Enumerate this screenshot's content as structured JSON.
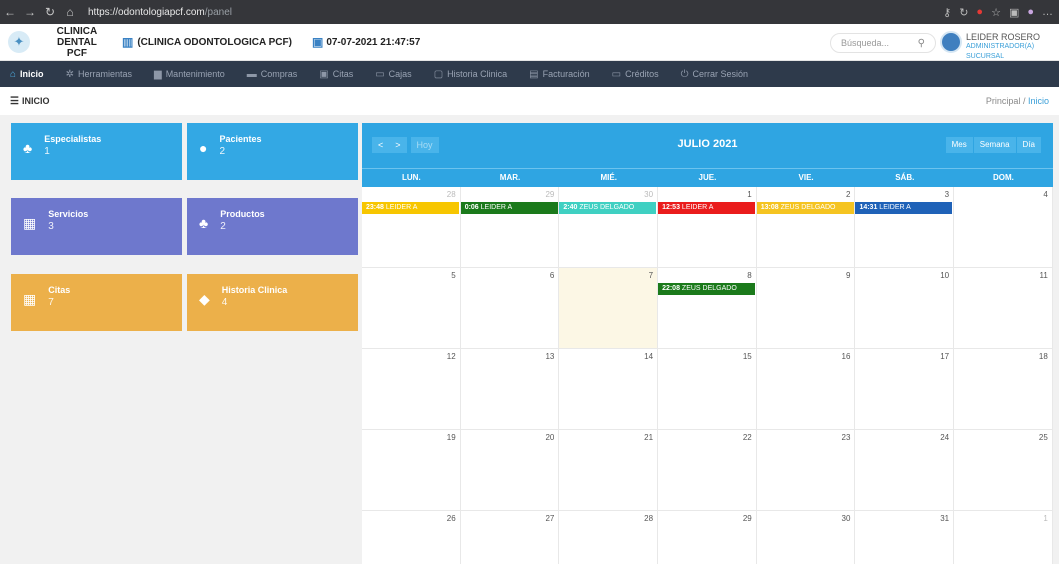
{
  "browser": {
    "url_base": "https://odontologiapcf.com",
    "url_path": "/panel"
  },
  "header": {
    "logo_line1": "CLINICA DENTAL",
    "logo_line2": "PCF",
    "clinic": "(CLINICA ODONTOLOGICA PCF)",
    "datetime": "07-07-2021 21:47:57",
    "search_placeholder": "Búsqueda...",
    "user_name": "LEIDER ROSERO",
    "user_role": "ADMINISTRADOR(A) SUCURSAL"
  },
  "nav": [
    {
      "label": "Inicio",
      "icon": "home-icon",
      "glyph": "⌂",
      "active": true
    },
    {
      "label": "Herramientas",
      "icon": "gear-icon",
      "glyph": "✲",
      "active": false
    },
    {
      "label": "Mantenimiento",
      "icon": "folder-icon",
      "glyph": "▆",
      "active": false
    },
    {
      "label": "Compras",
      "icon": "cart-icon",
      "glyph": "▬",
      "active": false
    },
    {
      "label": "Citas",
      "icon": "calendar-icon",
      "glyph": "▣",
      "active": false
    },
    {
      "label": "Cajas",
      "icon": "monitor-icon",
      "glyph": "▭",
      "active": false
    },
    {
      "label": "Historia Clinica",
      "icon": "chat-icon",
      "glyph": "▢",
      "active": false
    },
    {
      "label": "Facturación",
      "icon": "register-icon",
      "glyph": "▤",
      "active": false
    },
    {
      "label": "Créditos",
      "icon": "card-icon",
      "glyph": "▭",
      "active": false
    },
    {
      "label": "Cerrar Sesión",
      "icon": "power-icon",
      "glyph": "⏻",
      "active": false
    }
  ],
  "page": {
    "title": "INICIO",
    "breadcrumb_root": "Principal",
    "breadcrumb_sep": "/",
    "breadcrumb_current": "Inicio"
  },
  "tiles": [
    {
      "name": "Especialistas",
      "count": "1",
      "icon": "user-tie-icon",
      "glyph": "♣",
      "color": "#33a8e4"
    },
    {
      "name": "Pacientes",
      "count": "2",
      "icon": "user-icon",
      "glyph": "●",
      "color": "#33a8e4"
    },
    {
      "name": "Servicios",
      "count": "3",
      "icon": "calculator-icon",
      "glyph": "▦",
      "color": "#6e78cd"
    },
    {
      "name": "Productos",
      "count": "2",
      "icon": "cubes-icon",
      "glyph": "♣",
      "color": "#6e78cd"
    },
    {
      "name": "Citas",
      "count": "7",
      "icon": "calendar-icon",
      "glyph": "▦",
      "color": "#ecb04a"
    },
    {
      "name": "Historia Clinica",
      "count": "4",
      "icon": "diamond-icon",
      "glyph": "◆",
      "color": "#ecb04a"
    }
  ],
  "calendar": {
    "title": "JULIO 2021",
    "prev": "<",
    "next": ">",
    "today": "Hoy",
    "views": [
      "Mes",
      "Semana",
      "Día"
    ],
    "weekdays": [
      "LUN.",
      "MAR.",
      "MIÉ.",
      "JUE.",
      "VIE.",
      "SÁB.",
      "DOM."
    ],
    "weeks": [
      [
        {
          "d": "28",
          "o": true
        },
        {
          "d": "29",
          "o": true
        },
        {
          "d": "30",
          "o": true
        },
        {
          "d": "1"
        },
        {
          "d": "2"
        },
        {
          "d": "3"
        },
        {
          "d": "4"
        }
      ],
      [
        {
          "d": "5"
        },
        {
          "d": "6"
        },
        {
          "d": "7",
          "today": true
        },
        {
          "d": "8"
        },
        {
          "d": "9"
        },
        {
          "d": "10"
        },
        {
          "d": "11"
        }
      ],
      [
        {
          "d": "12"
        },
        {
          "d": "13"
        },
        {
          "d": "14"
        },
        {
          "d": "15"
        },
        {
          "d": "16"
        },
        {
          "d": "17"
        },
        {
          "d": "18"
        }
      ],
      [
        {
          "d": "19"
        },
        {
          "d": "20"
        },
        {
          "d": "21"
        },
        {
          "d": "22"
        },
        {
          "d": "23"
        },
        {
          "d": "24"
        },
        {
          "d": "25"
        }
      ],
      [
        {
          "d": "26"
        },
        {
          "d": "27"
        },
        {
          "d": "28"
        },
        {
          "d": "29"
        },
        {
          "d": "30"
        },
        {
          "d": "31"
        },
        {
          "d": "1",
          "o": true
        }
      ]
    ],
    "events": [
      {
        "week": 0,
        "day": 0,
        "time": "23:48",
        "who": "LEIDER A",
        "color": "#f7c600"
      },
      {
        "week": 0,
        "day": 1,
        "time": "0:06",
        "who": "LEIDER A",
        "color": "#1b7a1b"
      },
      {
        "week": 0,
        "day": 2,
        "time": "2:40",
        "who": "ZEUS DELGADO",
        "color": "#3fd0c2"
      },
      {
        "week": 0,
        "day": 3,
        "time": "12:53",
        "who": "LEIDER A",
        "color": "#ea1c1c"
      },
      {
        "week": 0,
        "day": 4,
        "time": "13:08",
        "who": "ZEUS DELGADO",
        "color": "#f5c421"
      },
      {
        "week": 0,
        "day": 5,
        "time": "14:31",
        "who": "LEIDER A",
        "color": "#1f62b8"
      },
      {
        "week": 1,
        "day": 3,
        "time": "22:08",
        "who": "ZEUS DELGADO",
        "color": "#1b7a1b"
      }
    ]
  }
}
